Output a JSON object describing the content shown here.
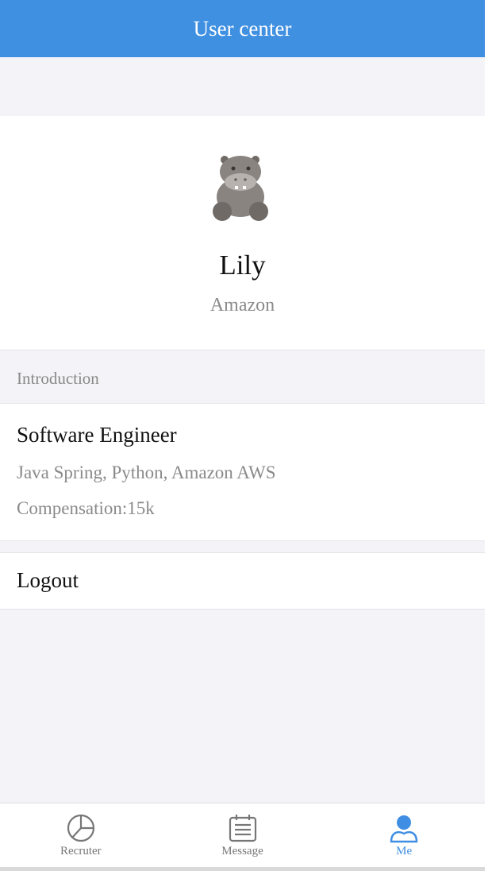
{
  "navbar": {
    "title": "User center"
  },
  "profile": {
    "avatar_icon": "hippo-avatar-icon",
    "name": "Lily",
    "company": "Amazon"
  },
  "introduction": {
    "header": "Introduction",
    "title": "Software Engineer",
    "skills": "Java Spring, Python, Amazon AWS",
    "compensation": "Compensation:15k"
  },
  "logout": {
    "label": "Logout"
  },
  "tabbar": {
    "active_color": "#3f8ee3",
    "inactive_color": "#777777",
    "tabs": [
      {
        "label": "Recruter",
        "icon": "pie-chart-icon",
        "active": false
      },
      {
        "label": "Message",
        "icon": "calendar-icon",
        "active": false
      },
      {
        "label": "Me",
        "icon": "user-icon",
        "active": true
      }
    ]
  },
  "colors": {
    "navbar": "#4090e2",
    "page_background": "#f4f4f8"
  }
}
